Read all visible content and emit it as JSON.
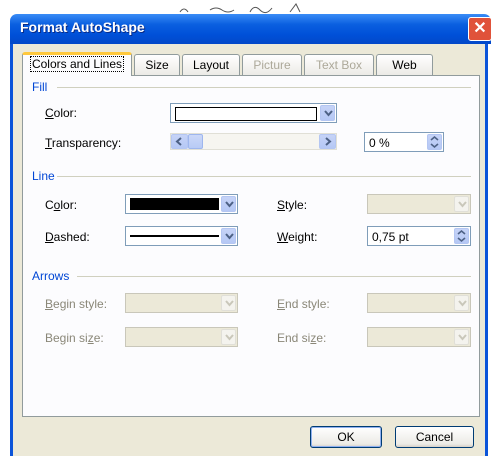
{
  "dialog": {
    "title": "Format AutoShape",
    "close_glyph": "✕"
  },
  "tabs": [
    {
      "label": "Colors and Lines",
      "state": "active"
    },
    {
      "label": "Size",
      "state": "normal"
    },
    {
      "label": "Layout",
      "state": "normal"
    },
    {
      "label": "Picture",
      "state": "disabled"
    },
    {
      "label": "Text Box",
      "state": "disabled"
    },
    {
      "label": "Web",
      "state": "normal"
    }
  ],
  "fill": {
    "section_label": "Fill",
    "color_label_pre": "",
    "color_label_ul": "C",
    "color_label_post": "olor:",
    "color_value": "#ffffff",
    "transparency_label_ul": "T",
    "transparency_label_post": "ransparency:",
    "transparency_value": "0 %",
    "transparency_level_percent": 0
  },
  "line": {
    "section_label": "Line",
    "color_label_pre": "C",
    "color_label_ul": "o",
    "color_label_post": "lor:",
    "color_value": "#000000",
    "dashed_label_ul": "D",
    "dashed_label_post": "ashed:",
    "style_label_ul": "S",
    "style_label_post": "tyle:",
    "weight_label_ul": "W",
    "weight_label_post": "eight:",
    "weight_value": "0,75 pt"
  },
  "arrows": {
    "section_label": "Arrows",
    "begin_style_label_ul": "B",
    "begin_style_label_post": "egin style:",
    "begin_size_label_pre": "Begin si",
    "begin_size_label_ul": "z",
    "begin_size_label_post": "e:",
    "end_style_label_ul": "E",
    "end_style_label_post": "nd style:",
    "end_size_label_pre": "End si",
    "end_size_label_ul": "z",
    "end_size_label_post": "e:"
  },
  "buttons": {
    "ok": "OK",
    "cancel": "Cancel"
  },
  "colors": {
    "title_bar": "#0050d8",
    "section_text": "#0046d5",
    "dialog_face": "#ece9d8",
    "close_button": "#e0523a"
  }
}
